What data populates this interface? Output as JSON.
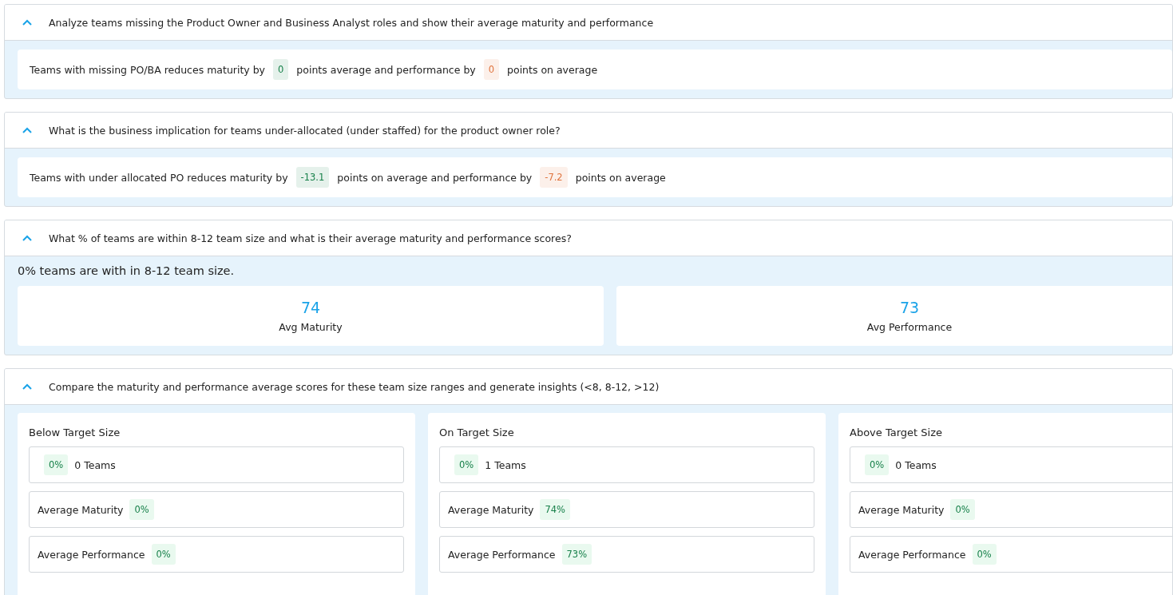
{
  "sections": [
    {
      "kind": "insight",
      "expanded": true,
      "question": "Analyze teams missing the Product Owner and Business Analyst roles and show their average maturity and performance",
      "parts": [
        {
          "kind": "text",
          "text": "Teams with missing PO/BA reduces maturity by"
        },
        {
          "kind": "badge",
          "color": "#17804a",
          "text": "0"
        },
        {
          "kind": "text",
          "text": "points average and performance by"
        },
        {
          "kind": "badge",
          "color": "#e0743e",
          "text": "0"
        },
        {
          "kind": "text",
          "text": "points on average"
        }
      ]
    },
    {
      "kind": "insight",
      "expanded": true,
      "question": "What is the business implication for teams under-allocated (under staffed) for the product owner role?",
      "parts": [
        {
          "kind": "text",
          "text": "Teams with under allocated PO reduces maturity by"
        },
        {
          "kind": "badge",
          "color": "#17804a",
          "text": "-13.1"
        },
        {
          "kind": "text",
          "text": "points on average and performance by"
        },
        {
          "kind": "badge",
          "color": "#e0743e",
          "text": "-7.2"
        },
        {
          "kind": "text",
          "text": "points on average"
        }
      ]
    },
    {
      "kind": "stats",
      "expanded": true,
      "question": "What % of teams are within 8-12 team size and what is their average maturity and performance scores?",
      "summary": "0% teams are with in 8-12 team size.",
      "stats": [
        {
          "value": "74",
          "label": "Avg Maturity"
        },
        {
          "value": "73",
          "label": "Avg Performance"
        }
      ]
    },
    {
      "kind": "groups",
      "expanded": true,
      "question": "Compare the maturity and performance average scores for these team size ranges and generate insights (<8, 8-12, >12)",
      "groups": [
        {
          "title": "Below Target Size",
          "rows": [
            {
              "kind": "count",
              "badge": "0%",
              "label": "0 Teams"
            },
            {
              "kind": "metric",
              "label": "Average Maturity",
              "badge": "0%"
            },
            {
              "kind": "metric",
              "label": "Average Performance",
              "badge": "0%"
            }
          ]
        },
        {
          "title": "On Target Size",
          "rows": [
            {
              "kind": "count",
              "badge": "0%",
              "label": "1 Teams"
            },
            {
              "kind": "metric",
              "label": "Average Maturity",
              "badge": "74%"
            },
            {
              "kind": "metric",
              "label": "Average Performance",
              "badge": "73%"
            }
          ]
        },
        {
          "title": "Above Target Size",
          "rows": [
            {
              "kind": "count",
              "badge": "0%",
              "label": "0 Teams"
            },
            {
              "kind": "metric",
              "label": "Average Maturity",
              "badge": "0%"
            },
            {
              "kind": "metric",
              "label": "Average Performance",
              "badge": "0%"
            }
          ]
        }
      ]
    }
  ]
}
